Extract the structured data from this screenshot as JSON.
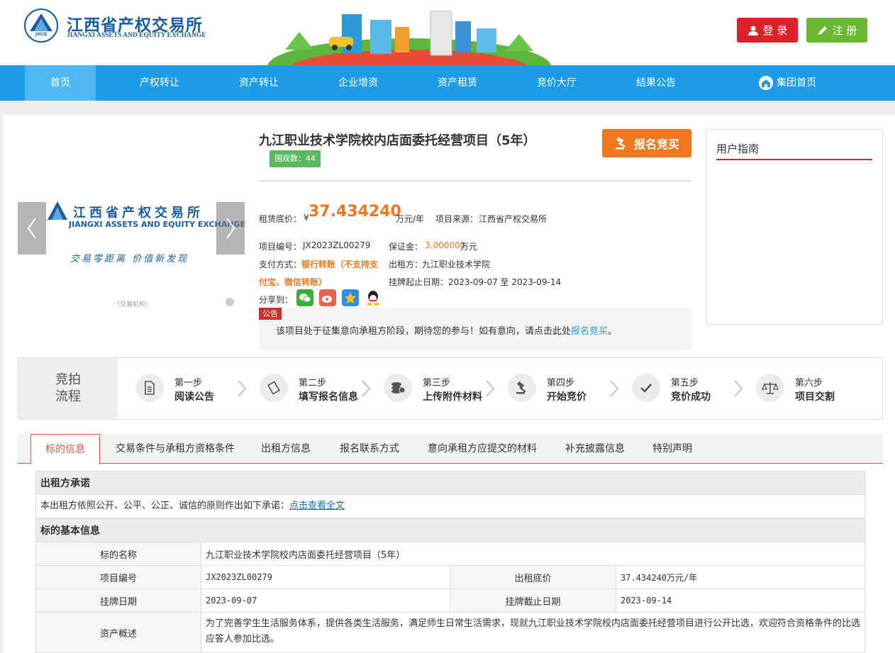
{
  "header": {
    "logo_cn": "江西省产权交易所",
    "logo_en": "JIANGXI ASSETS AND EQUITY EXCHANGE",
    "logo_mark": "JXCQ",
    "login_label": "登 录",
    "register_label": "注 册"
  },
  "nav": [
    {
      "label": "首页"
    },
    {
      "label": "产权转让"
    },
    {
      "label": "资产转让"
    },
    {
      "label": "企业增资"
    },
    {
      "label": "资产租赁"
    },
    {
      "label": "竞价大厅"
    },
    {
      "label": "结果公告"
    },
    {
      "label": "集团首页"
    }
  ],
  "carousel": {
    "logo_cn": "江西省产权交易所",
    "logo_en": "JIANGXI ASSETS AND EQUITY EXCHANGE",
    "slogan": "交易零距离  价值新发现",
    "tag": "（交易机构）"
  },
  "project": {
    "title": "九江职业技术学院校内店面委托经营项目（5年）",
    "views": "围观数：44",
    "bid_button": "报名竞买",
    "price_label": "租赁底价：",
    "currency": "¥",
    "price": "37.434240",
    "price_unit": "万元/年",
    "source_label": "项目来源：",
    "source": "江西省产权交易所",
    "code_label": "项目编号：",
    "code": "JX2023ZL00279",
    "deposit_label": "保证金：",
    "deposit": "3.000000",
    "deposit_unit": "万元",
    "payment_label": "支付方式：",
    "payment_line1": "银行转账（不支持支",
    "payment_line2": "付宝、微信转账）",
    "lessor_label": "出租方：",
    "lessor": "九江职业技术学院",
    "period_label": "挂牌起止日期：",
    "period": "2023-09-07 至 2023-09-14",
    "share_label": "分享到："
  },
  "notice": {
    "tag": "公告",
    "text": "该项目处于征集意向承租方阶段，期待您的参与！如有意向，请点击此处",
    "link": "报名竞买",
    "end": "。"
  },
  "guide": {
    "title": "用户指南"
  },
  "process": {
    "head_line1": "竞拍",
    "head_line2": "流程",
    "steps": [
      {
        "num": "第一步",
        "name": "阅读公告"
      },
      {
        "num": "第二步",
        "name": "填写报名信息"
      },
      {
        "num": "第三步",
        "name": "上传附件材料"
      },
      {
        "num": "第四步",
        "name": "开始竞价"
      },
      {
        "num": "第五步",
        "name": "竞价成功"
      },
      {
        "num": "第六步",
        "name": "项目交割"
      }
    ]
  },
  "tabs": [
    {
      "label": "标的信息"
    },
    {
      "label": "交易条件与承租方资格条件"
    },
    {
      "label": "出租方信息"
    },
    {
      "label": "报名联系方式"
    },
    {
      "label": "意向承租方应提交的材料"
    },
    {
      "label": "补充披露信息"
    },
    {
      "label": "特别声明"
    }
  ],
  "promise": {
    "title": "出租方承诺",
    "text": "本出租方依照公开、公平、公正、诚信的原则作出如下承诺：",
    "link": "点击查看全文"
  },
  "basic": {
    "title": "标的基本信息",
    "name_label": "标的名称",
    "name": "九江职业技术学院校内店面委托经营项目（5年）",
    "code_label": "项目编号",
    "code": "JX2023ZL00279",
    "price_label": "出租底价",
    "price": "37.434240万元/年",
    "start_label": "挂牌日期",
    "start": "2023-09-07",
    "end_label": "挂牌截止日期",
    "end": "2023-09-14",
    "desc_label": "资产概述",
    "desc": "为了完善学生生活服务体系，提供各类生活服务，满足师生日常生活需求，现就九江职业技术学院校内店面委托经营项目进行公开比选，欢迎符合资格条件的比选应答人参加比选。"
  },
  "colors": {
    "nav": "#1e9be6",
    "accent": "#f07820",
    "login": "#d9222a",
    "register": "#6bb833"
  }
}
